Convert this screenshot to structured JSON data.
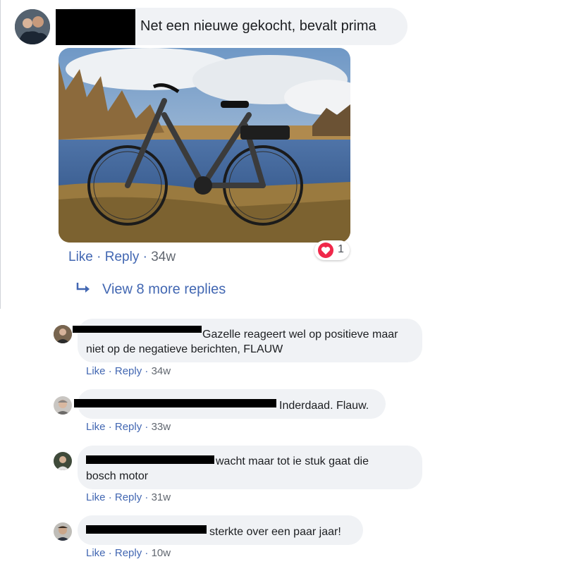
{
  "post": {
    "text": "Net een nieuwe gekocht, bevalt prima",
    "actions": {
      "like": "Like",
      "reply": "Reply",
      "sep": "·",
      "time": "34w"
    },
    "reaction_count": "1",
    "view_more": "View 8 more replies"
  },
  "replies": [
    {
      "line1": "Gazelle reageert wel op positieve maar",
      "line2": "niet op de negatieve berichten, FLAUW",
      "like": "Like",
      "reply": "Reply",
      "sep": "·",
      "time": "34w"
    },
    {
      "line1": "Inderdaad. Flauw.",
      "like": "Like",
      "reply": "Reply",
      "sep": "·",
      "time": "33w"
    },
    {
      "line1": "wacht maar tot ie stuk gaat die",
      "line2": "bosch motor",
      "like": "Like",
      "reply": "Reply",
      "sep": "·",
      "time": "31w"
    },
    {
      "line1": "sterkte over een paar jaar!",
      "like": "Like",
      "reply": "Reply",
      "sep": "·",
      "time": "10w"
    }
  ],
  "colors": {
    "link": "#4267b2",
    "bubble": "#f0f2f5",
    "heart": "#f0284a",
    "muted": "#616770"
  }
}
